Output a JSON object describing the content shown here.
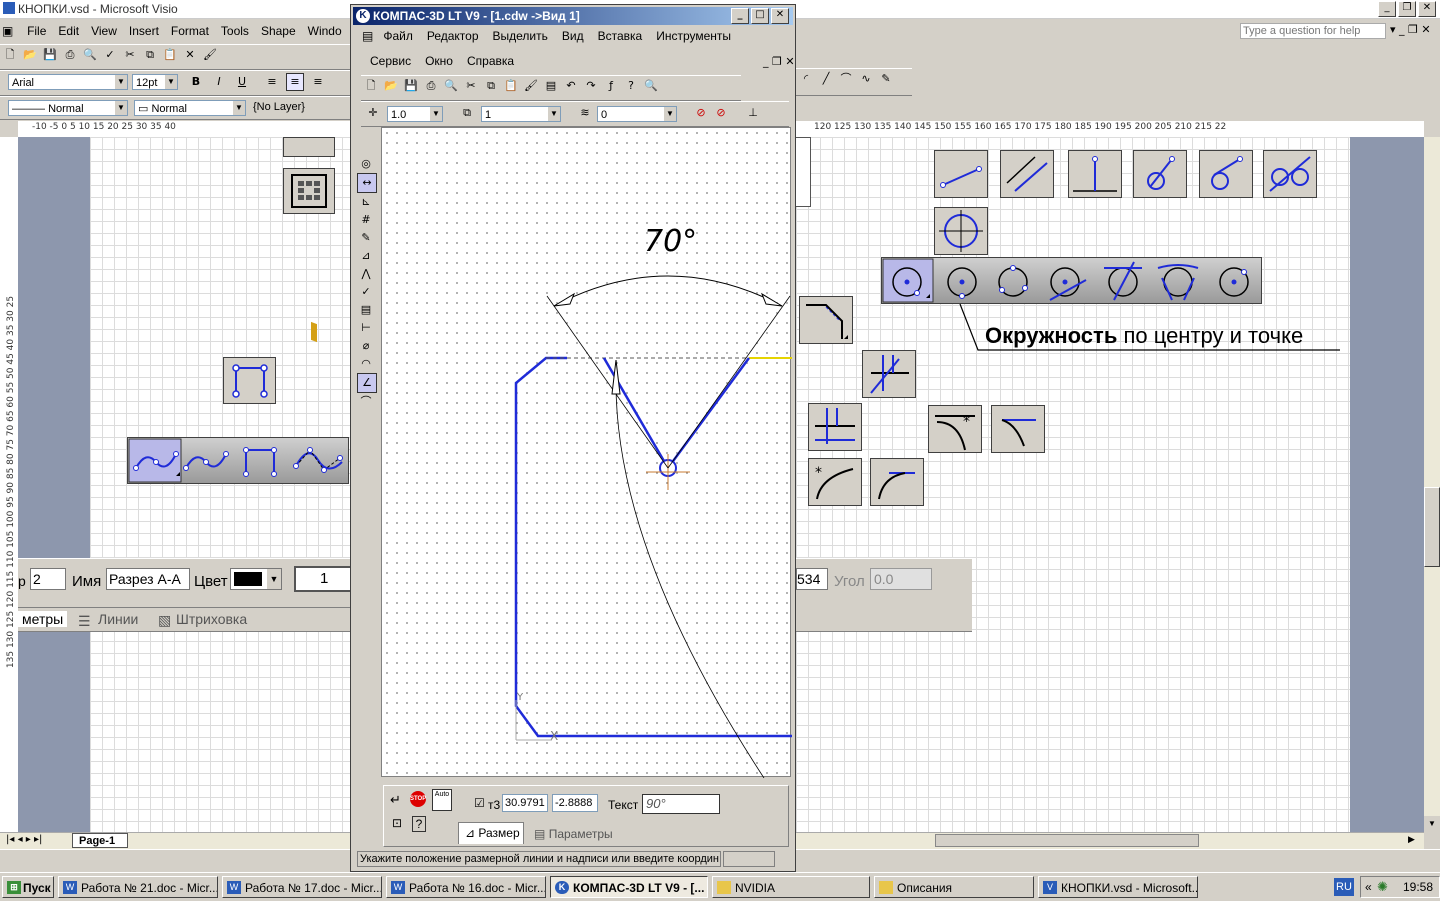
{
  "visio": {
    "title": "КНОПКИ.vsd - Microsoft Visio",
    "menu": [
      "File",
      "Edit",
      "View",
      "Insert",
      "Format",
      "Tools",
      "Shape",
      "Windo"
    ],
    "help_placeholder": "Type a question for help",
    "font_name": "Arial",
    "font_size": "12pt",
    "line_style": "Normal",
    "fill_style": "Normal",
    "layer": "{No Layer}",
    "top_ruler_left": "-10  -5   0    5   10   15   20   25   30   35   40",
    "top_ruler_right": "120  125  130  135  140  145  150  155  160  165  170  175  180  185  190  195  200  205  210  215  22",
    "left_ruler": "135 130 125 120 115 110 105 100 95 90 85 80 75 70 65 60 55 50 45 40 35 30 25",
    "page_tab": "Page-1",
    "callout": {
      "bold": "Окружность",
      "rest": " по центру и точке"
    },
    "prop_panel": {
      "field1_label": "р",
      "field1_value": "2",
      "name_label": "Имя",
      "name_value": "Разрез А-А",
      "color_label": "Цвет",
      "num_value": "1",
      "right_value": "534",
      "angle_label": "Угол",
      "angle_value": "0.0",
      "tabs": [
        "метры",
        "Линии",
        "Штриховка"
      ]
    }
  },
  "kompas": {
    "title": "КОМПАС-3D LT V9 - [1.cdw ->Вид 1]",
    "menu1": [
      "Файл",
      "Редактор",
      "Выделить",
      "Вид",
      "Вставка",
      "Инструменты"
    ],
    "menu2": [
      "Сервис",
      "Окно",
      "Справка"
    ],
    "scale_value": "1.0",
    "layer_value": "1",
    "style_value": "0",
    "dimension_text": "70°",
    "point_label": "т3",
    "x_value": "30.9791",
    "y_value": "-2.8888",
    "text_label": "Текст",
    "text_value": "90°",
    "tab_size": "Размер",
    "tab_params": "Параметры",
    "status": "Укажите положение размерной линии и надписи или введите координ"
  },
  "taskbar": {
    "start": "Пуск",
    "items": [
      "Работа № 21.doc - Micr...",
      "Работа № 17.doc - Micr...",
      "Работа № 16.doc - Micr...",
      "КОМПАС-3D LT V9 - [...",
      "NVIDIA",
      "Описания",
      "КНОПКИ.vsd - Microsoft..."
    ],
    "lang": "RU",
    "clock": "19:58"
  },
  "colors": {
    "accent": "#0a246a",
    "line_blue": "#1f2bd8",
    "highlight": "#b8b8e8"
  }
}
